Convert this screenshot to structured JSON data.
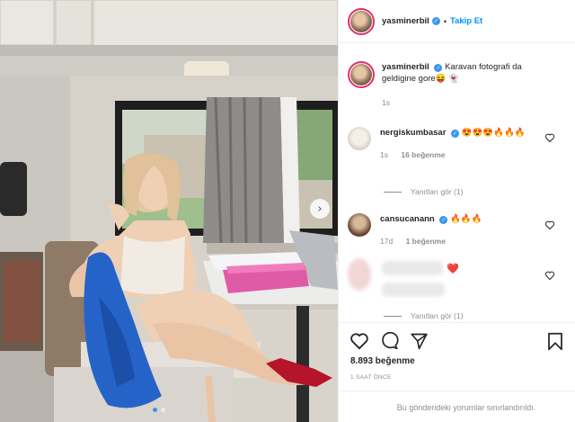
{
  "post": {
    "username": "yasminerbil",
    "follow_label": "Takip Et",
    "separator": "•",
    "caption": "Karavan fotografi da geldigine gore😝 👻",
    "caption_time": "1s"
  },
  "comments": [
    {
      "username": "nergiskumbasar",
      "text": "😍😍😍🔥🔥🔥",
      "time": "1s",
      "likes": "16 beğenme",
      "replies": "Yanıtları gör (1)"
    },
    {
      "username": "cansucanann",
      "text": "🔥🔥🔥",
      "time": "17d",
      "likes": "1 beğenme"
    },
    {
      "username": "",
      "text": "❤️",
      "replies": "Yanıtları gör (1)"
    }
  ],
  "actions": {
    "likes": "8.893 beğenme",
    "time": "1 SAAT ÖNCE",
    "restricted": "Bu gönderideki yorumlar sınırlandırıldı."
  },
  "icons": {
    "heart": "heart-icon",
    "comment": "comment-icon",
    "share": "share-icon",
    "bookmark": "bookmark-icon",
    "next": "chevron-right-icon"
  },
  "colors": {
    "accent": "#0095f6",
    "verified": "#3897f0",
    "secondary_text": "#8e8e8e",
    "heart_red": "#ed4956"
  },
  "carousel": {
    "slides": 2,
    "active": 1
  }
}
